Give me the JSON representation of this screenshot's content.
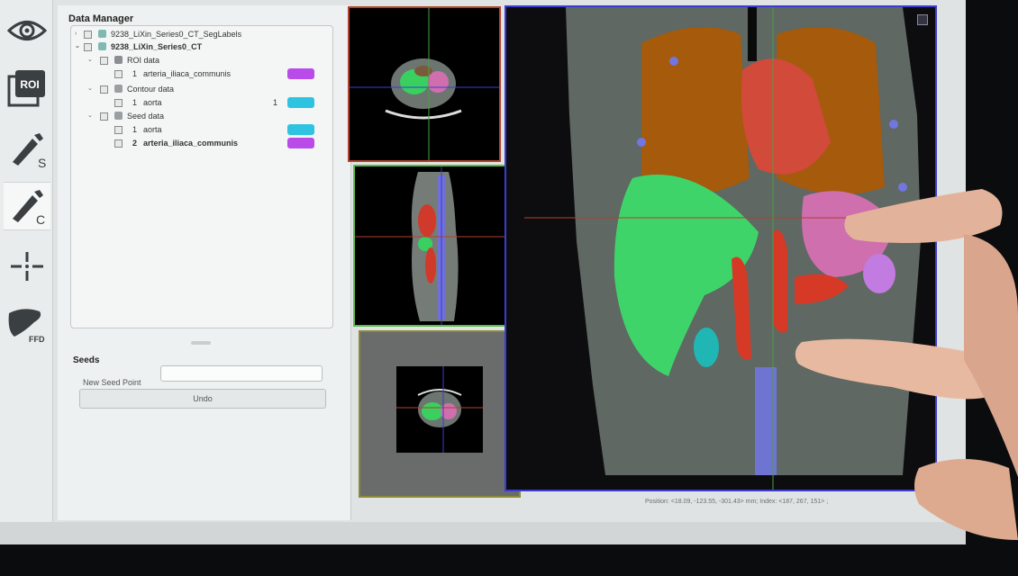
{
  "data_manager": {
    "title": "Data Manager",
    "tree": [
      {
        "label": "9238_LiXin_Series0_CT_SegLabels",
        "bold": false
      },
      {
        "label": "9238_LiXin_Series0_CT",
        "bold": true
      },
      {
        "label": "ROI data"
      },
      {
        "index": "1",
        "label": "arteria_iliaca_communis",
        "color": "#b94ce8"
      },
      {
        "label": "Contour data"
      },
      {
        "index": "1",
        "label": "aorta",
        "count": "1",
        "color": "#2ec3e0"
      },
      {
        "label": "Seed data"
      },
      {
        "index": "1",
        "label": "aorta",
        "color": "#2ec3e0"
      },
      {
        "index": "2",
        "label": "arteria_iliaca_communis",
        "color": "#b94ce8"
      }
    ]
  },
  "seeds": {
    "title": "Seeds",
    "new_seed_label": "New Seed Point",
    "new_seed_value": "",
    "undo_label": "Undo"
  },
  "toolbar": {
    "icons": [
      "eye-icon",
      "roi-icon",
      "seed-pen-icon",
      "contour-pen-icon",
      "crosshair-icon",
      "liver-ffd-icon"
    ],
    "roi_label": "ROI",
    "seed_letter": "S",
    "contour_letter": "C",
    "ffd_label": "FFD"
  },
  "status": {
    "text": "Position: <18.09, -123.55, -301.43> mm; Index: <187, 267, 151> ; "
  },
  "colors": {
    "axial_border": "#b3412c",
    "sagittal_border": "#5dbb4a",
    "coronal_border": "#8c8a3a",
    "main_border": "#3c3cd2"
  }
}
